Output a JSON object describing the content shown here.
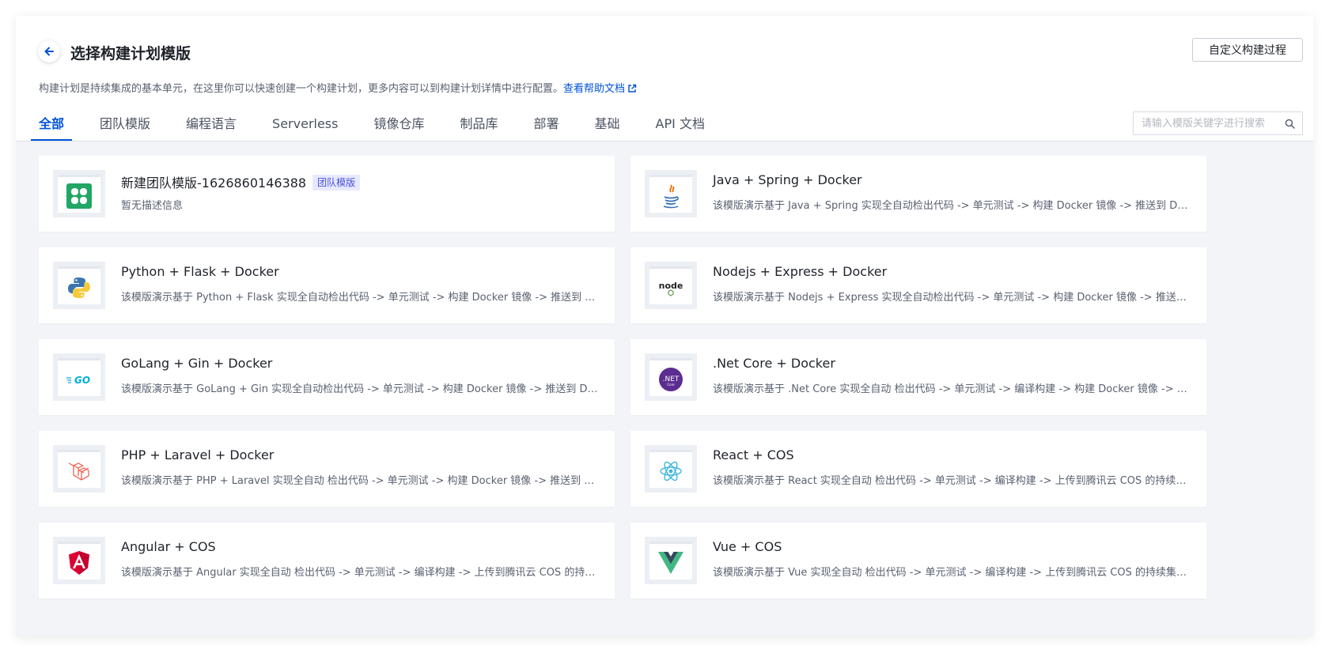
{
  "header": {
    "title": "选择构建计划模版",
    "custom_button": "自定义构建过程",
    "description": "构建计划是持续集成的基本单元，在这里你可以快速创建一个构建计划，更多内容可以到构建计划详情中进行配置。",
    "help_link": "查看帮助文档"
  },
  "tabs": [
    {
      "label": "全部",
      "active": true
    },
    {
      "label": "团队模版"
    },
    {
      "label": "编程语言"
    },
    {
      "label": "Serverless"
    },
    {
      "label": "镜像仓库"
    },
    {
      "label": "制品库"
    },
    {
      "label": "部署"
    },
    {
      "label": "基础"
    },
    {
      "label": "API 文档"
    }
  ],
  "search": {
    "placeholder": "请输入模版关键字进行搜索",
    "value": ""
  },
  "colors": {
    "primary": "#0052d9",
    "background": "#f2f4f8",
    "badge_bg": "#e6e9ff",
    "badge_text": "#4c4fd6"
  },
  "templates": [
    {
      "name": "新建团队模版-1626860146388",
      "badge": "团队模版",
      "description": "暂无描述信息",
      "icon": "team-template-icon"
    },
    {
      "name": "Java + Spring + Docker",
      "description": "该模版演示基于 Java + Spring 实现全自动检出代码 -> 单元测试 -> 构建 Docker 镜像 -> 推送到 Docker 仓库",
      "icon": "java-icon"
    },
    {
      "name": "Python + Flask + Docker",
      "description": "该模版演示基于 Python + Flask 实现全自动检出代码 -> 单元测试 -> 构建 Docker 镜像 -> 推送到 Docker 仓库",
      "icon": "python-icon"
    },
    {
      "name": "Nodejs + Express + Docker",
      "description": "该模版演示基于 Nodejs + Express 实现全自动检出代码 -> 单元测试 -> 构建 Docker 镜像 -> 推送到 Docker 仓库",
      "icon": "nodejs-icon"
    },
    {
      "name": "GoLang + Gin + Docker",
      "description": "该模版演示基于 GoLang + Gin 实现全自动检出代码 -> 单元测试 -> 构建 Docker 镜像 -> 推送到 Docker 仓库",
      "icon": "golang-icon"
    },
    {
      "name": ".Net Core + Docker",
      "description": "该模版演示基于 .Net Core 实现全自动 检出代码 -> 单元测试 -> 编译构建 -> 构建 Docker 镜像 -> 推送到 Docker 仓库",
      "icon": "dotnet-icon"
    },
    {
      "name": "PHP + Laravel + Docker",
      "description": "该模版演示基于 PHP + Laravel 实现全自动 检出代码 -> 单元测试 -> 构建 Docker 镜像 -> 推送到 Docker 仓库",
      "icon": "laravel-icon"
    },
    {
      "name": "React + COS",
      "description": "该模版演示基于 React 实现全自动 检出代码 -> 单元测试 -> 编译构建 -> 上传到腾讯云 COS 的持续集成过程",
      "icon": "react-icon"
    },
    {
      "name": "Angular + COS",
      "description": "该模版演示基于 Angular 实现全自动 检出代码 -> 单元测试 -> 编译构建 -> 上传到腾讯云 COS 的持续集成过程",
      "icon": "angular-icon"
    },
    {
      "name": "Vue + COS",
      "description": "该模版演示基于 Vue 实现全自动 检出代码 -> 单元测试 -> 编译构建 -> 上传到腾讯云 COS 的持续集成过程",
      "icon": "vue-icon"
    }
  ]
}
